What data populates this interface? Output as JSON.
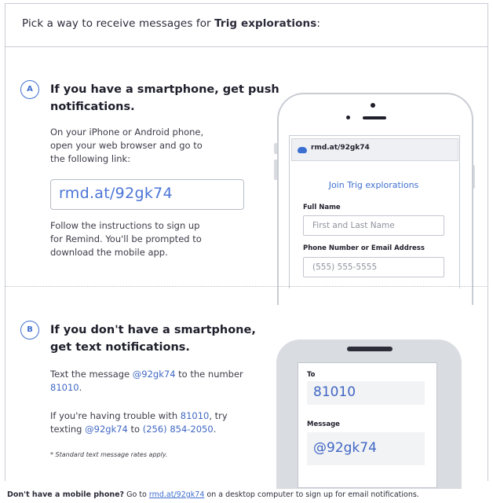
{
  "header": {
    "prefix": "Pick a way to receive messages for ",
    "class_name": "Trig explorations",
    "suffix": ":"
  },
  "option_a": {
    "badge": "A",
    "heading_line1": "If you have a smartphone, get push",
    "heading_line2": "notifications.",
    "instr_line1": "On your iPhone or Android phone,",
    "instr_line2": "open your web browser and go to",
    "instr_line3": "the following link:",
    "link": "rmd.at/92gk74",
    "follow_line1": "Follow the instructions to sign up",
    "follow_line2": "for Remind. You'll be prompted to",
    "follow_line3": "download the mobile app.",
    "phone": {
      "url": "rmd.at/92gk74",
      "join_title": "Join Trig explorations",
      "full_name_label": "Full Name",
      "full_name_placeholder": "First and Last Name",
      "contact_label": "Phone Number or Email Address",
      "contact_placeholder": "(555) 555-5555"
    }
  },
  "option_b": {
    "badge": "B",
    "heading_line1": "If you don't have a smartphone,",
    "heading_line2": "get text notifications.",
    "text_prefix": "Text the message ",
    "code": "@92gk74",
    "text_mid": " to the number",
    "number": "81010",
    "number_suffix": ".",
    "trouble_prefix": "If you're having trouble with ",
    "trouble_number": "81010",
    "trouble_suffix": ", try",
    "texting_prefix": "texting ",
    "texting_code": "@92gk74",
    "texting_mid": " to ",
    "alt_number": "(256) 854-2050",
    "texting_suffix": ".",
    "note": "* Standard text message rates apply.",
    "phone": {
      "to_label": "To",
      "to_value": "81010",
      "message_label": "Message",
      "message_value": "@92gk74"
    }
  },
  "footer": {
    "bold": "Don't have a mobile phone?",
    "go_to": " Go to ",
    "link": "rmd.at/92gk74",
    "rest": " on a desktop computer to sign up for email notifications."
  },
  "colors": {
    "accent": "#3f6fcf",
    "text": "#2b2b3a",
    "border": "#c9ccd4"
  }
}
